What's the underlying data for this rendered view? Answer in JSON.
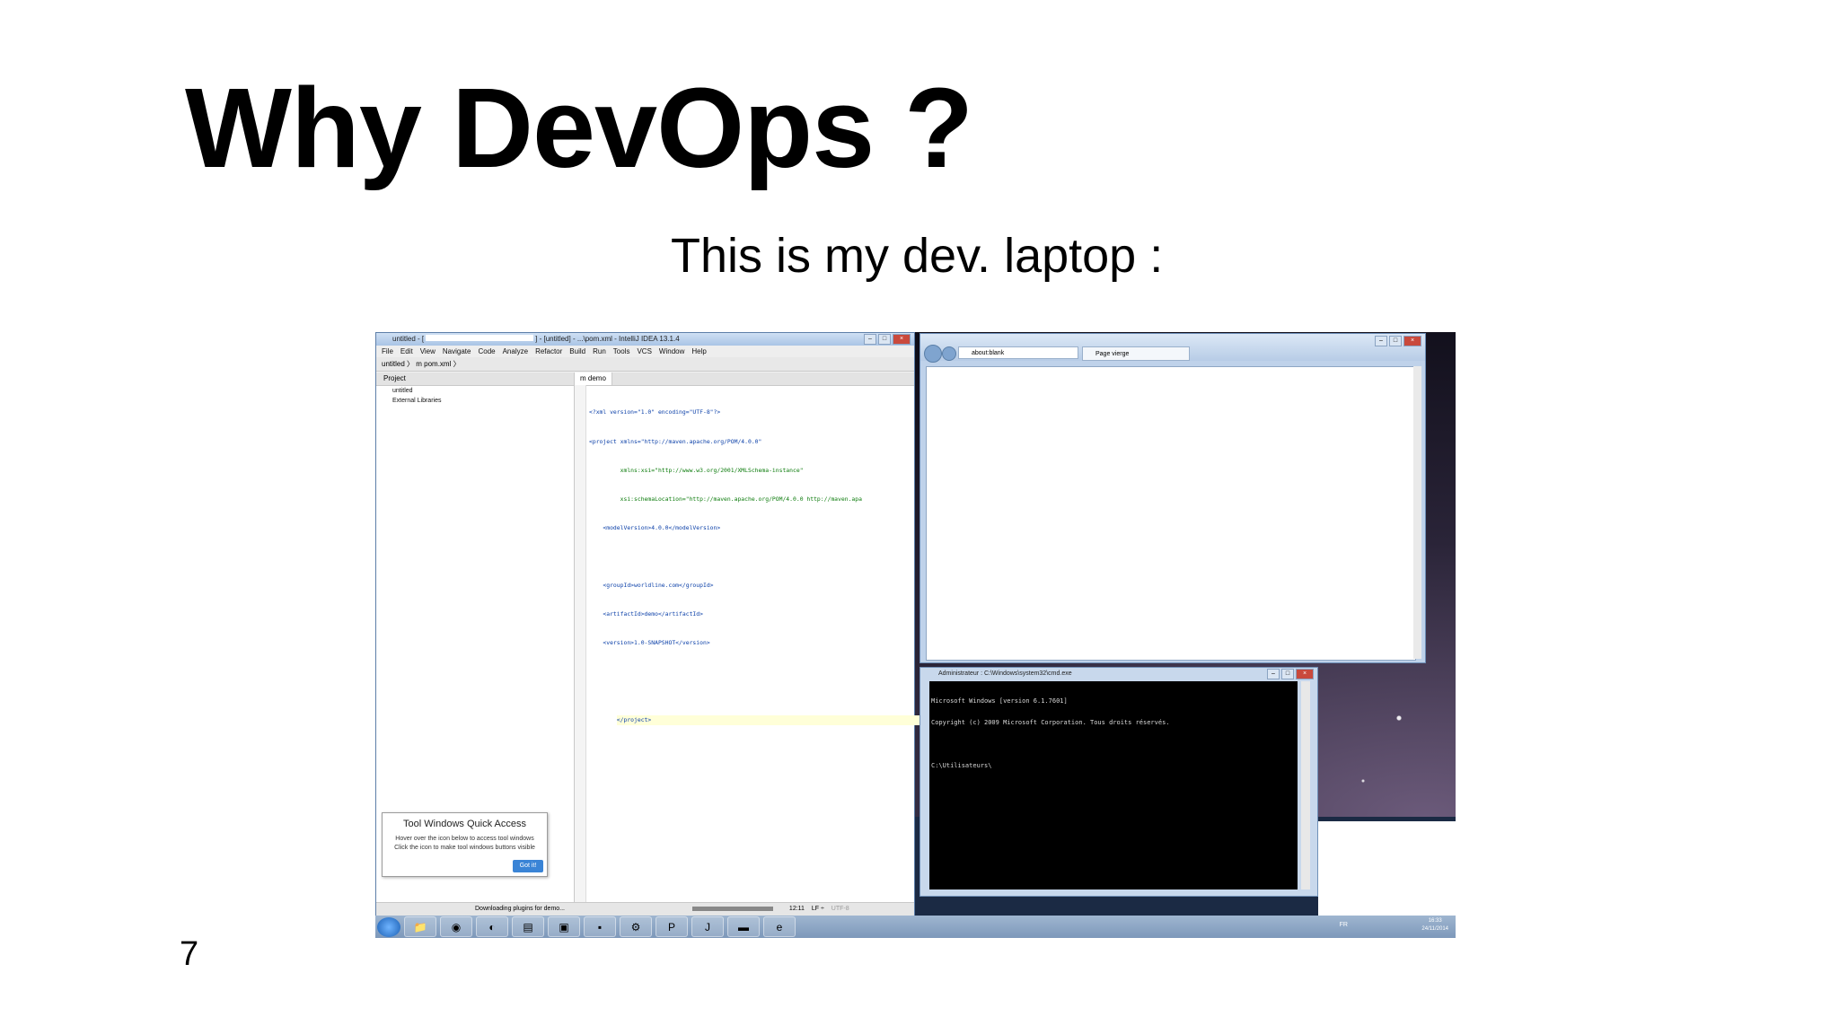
{
  "slide": {
    "title": "Why DevOps ?",
    "subtitle": "This is my dev. laptop :",
    "page_number": "7"
  },
  "ide": {
    "window_title": "untitled - [",
    "window_title_suffix": "] - [untitled] - ...\\pom.xml - IntelliJ IDEA 13.1.4",
    "menu": [
      "File",
      "Edit",
      "View",
      "Navigate",
      "Code",
      "Analyze",
      "Refactor",
      "Build",
      "Run",
      "Tools",
      "VCS",
      "Window",
      "Help"
    ],
    "breadcrumb": "untitled 〉 m pom.xml 〉",
    "project_header": "Project",
    "project_items": [
      "untitled",
      "External Libraries"
    ],
    "editor_tab": "m demo",
    "code_lines": [
      "<?xml version=\"1.0\" encoding=\"UTF-8\"?>",
      "<project xmlns=\"http://maven.apache.org/POM/4.0.0\"",
      "         xmlns:xsi=\"http://www.w3.org/2001/XMLSchema-instance\"",
      "         xsi:schemaLocation=\"http://maven.apache.org/POM/4.0.0 http://maven.apa",
      "    <modelVersion>4.0.0</modelVersion>",
      "",
      "    <groupId>worldline.com</groupId>",
      "    <artifactId>demo</artifactId>",
      "    <version>1.0-SNAPSHOT</version>",
      "",
      "",
      "</project>"
    ],
    "status_text": "Downloading plugins for demo...",
    "status_position": "12:11",
    "status_lf": "LF ÷",
    "status_encoding": "UTF-8",
    "tooltip": {
      "title": "Tool Windows Quick Access",
      "body_line1": "Hover over the icon below to access tool windows",
      "body_line2": "Click the icon to make tool windows buttons visible",
      "button": "Got it!"
    }
  },
  "browser": {
    "address": "about:blank",
    "tab_title": "Page vierge"
  },
  "cmd": {
    "title": "Administrateur : C:\\Windows\\system32\\cmd.exe",
    "lines": [
      "Microsoft Windows [version 6.1.7601]",
      "Copyright (c) 2009 Microsoft Corporation. Tous droits réservés.",
      "",
      "C:\\Utilisateurs\\"
    ]
  },
  "taskbar": {
    "items": [
      "folder-icon",
      "chrome-icon",
      "firefox-icon",
      "explorer-icon",
      "app-icon",
      "console-icon",
      "network-icon",
      "powerpoint-icon",
      "intellij-icon",
      "cmd-icon",
      "ie-icon"
    ],
    "lang": "FR",
    "time": "16:33",
    "date": "24/11/2014"
  }
}
